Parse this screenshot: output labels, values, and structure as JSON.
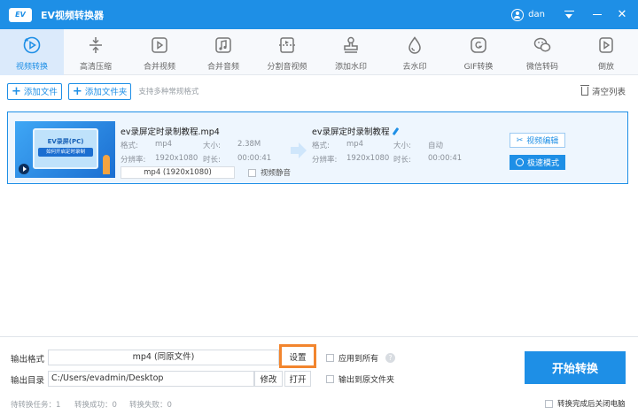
{
  "app": {
    "logo": "EV",
    "title": "EV视频转换器",
    "user": "dan"
  },
  "colors": {
    "primary": "#1e8fe6",
    "highlight": "#f2852e"
  },
  "toolbar": [
    {
      "label": "视频转换",
      "icon": "video-convert-icon",
      "active": true
    },
    {
      "label": "高清压缩",
      "icon": "compress-icon"
    },
    {
      "label": "合并视频",
      "icon": "merge-video-icon"
    },
    {
      "label": "合并音频",
      "icon": "merge-audio-icon"
    },
    {
      "label": "分割音视频",
      "icon": "split-icon"
    },
    {
      "label": "添加水印",
      "icon": "stamp-icon"
    },
    {
      "label": "去水印",
      "icon": "drop-icon"
    },
    {
      "label": "GIF转换",
      "icon": "gif-icon"
    },
    {
      "label": "微信转码",
      "icon": "wechat-icon"
    },
    {
      "label": "倒放",
      "icon": "reverse-icon"
    }
  ],
  "actions": {
    "add_file": "添加文件",
    "add_folder": "添加文件夹",
    "hint": "支持多种常规格式",
    "clear_list": "清空列表"
  },
  "file": {
    "thumb_line1": "EV录屏(PC)",
    "thumb_line2": "如何开启定时录制",
    "source": {
      "name": "ev录屏定时录制教程.mp4",
      "format_label": "格式:",
      "format": "mp4",
      "size_label": "大小:",
      "size": "2.38M",
      "resolution_label": "分辨率:",
      "resolution": "1920x1080",
      "duration_label": "时长:",
      "duration": "00:00:41",
      "format_box": "mp4 (1920x1080)",
      "mute_label": "视频静音"
    },
    "target": {
      "name": "ev录屏定时录制教程",
      "format_label": "格式:",
      "format": "mp4",
      "size_label": "大小:",
      "size": "自动",
      "resolution_label": "分辨率:",
      "resolution": "1920x1080",
      "duration_label": "时长:",
      "duration": "00:00:41"
    },
    "edit_button": "视频编辑",
    "fast_button": "极速模式"
  },
  "bottom": {
    "output_format_label": "输出格式",
    "output_format": "mp4 (同原文件)",
    "settings_button": "设置",
    "apply_all": "应用到所有",
    "output_dir_label": "输出目录",
    "output_dir": "C:/Users/evadmin/Desktop",
    "modify_button": "修改",
    "open_button": "打开",
    "output_to_source": "输出到原文件夹",
    "start_button": "开始转换",
    "status_pending": "待转换任务：1",
    "status_success": "转换成功：0",
    "status_failed": "转换失败：0",
    "shutdown_label": "转换完成后关闭电脑"
  }
}
